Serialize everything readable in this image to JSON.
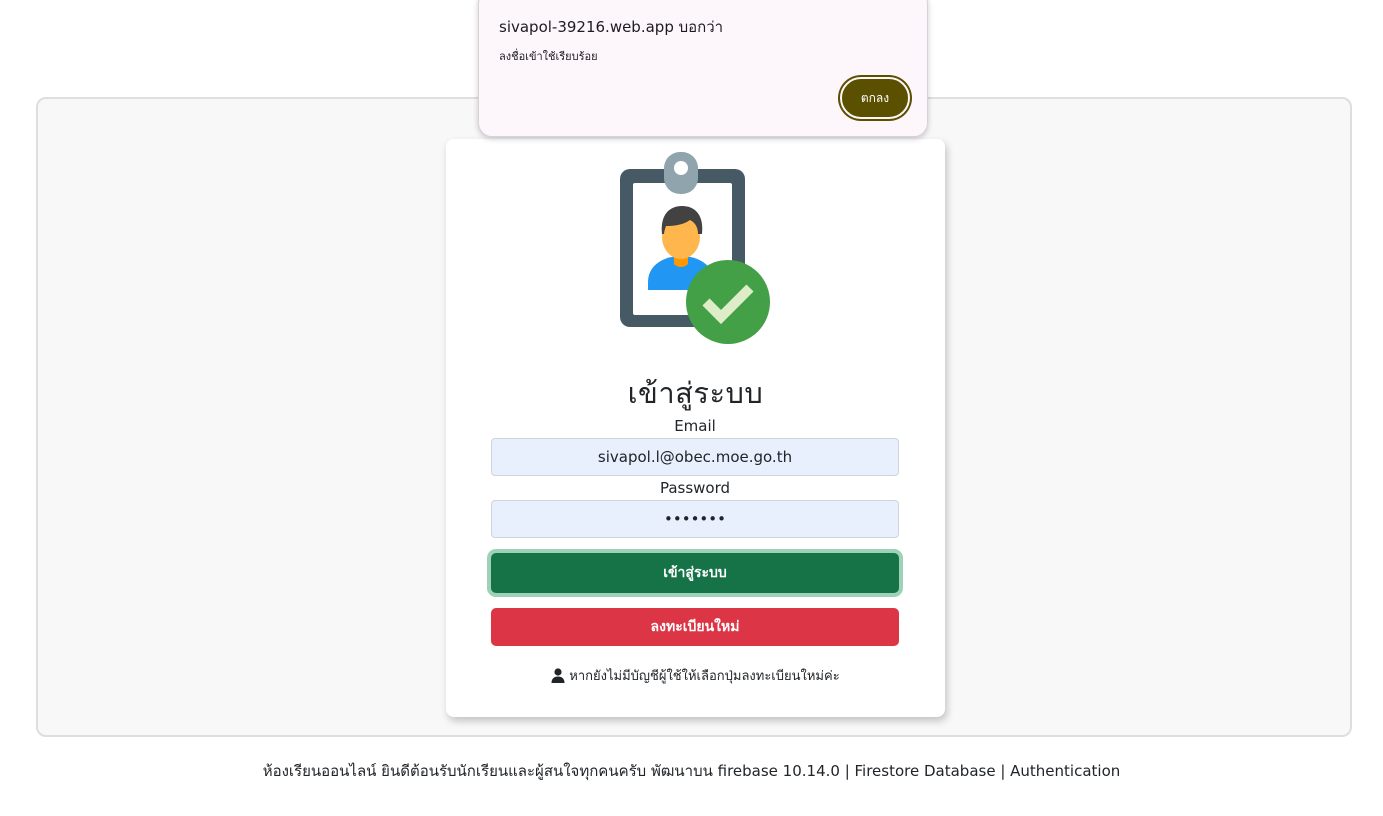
{
  "alert": {
    "origin": "sivapol-39216.web.app บอกว่า",
    "message": "ลงชื่อเข้าใช้เรียบร้อย",
    "ok_label": "ตกลง",
    "accent_color": "#5b4f00"
  },
  "login": {
    "title": "เข้าสู่ระบบ",
    "email_label": "Email",
    "email_value": "sivapol.l@obec.moe.go.th",
    "password_label": "Password",
    "password_value": "1234567",
    "login_button_label": "เข้าสู่ระบบ",
    "register_button_label": "ลงทะเบียนใหม่",
    "hint_text": "หากยังไม่มีบัญชีผู้ใช้ให้เลือกปุ่มลงทะเบียนใหม่ค่ะ",
    "hint_icon": "user-icon",
    "illustration_icon": "id-badge-check-icon",
    "login_button_color": "#157347",
    "register_button_color": "#dc3545"
  },
  "footer": {
    "text": "ห้องเรียนออนไลน์ ยินดีต้อนรับนักเรียนและผู้สนใจทุกคนครับ พัฒนาบน firebase 10.14.0 | Firestore Database | Authentication"
  }
}
